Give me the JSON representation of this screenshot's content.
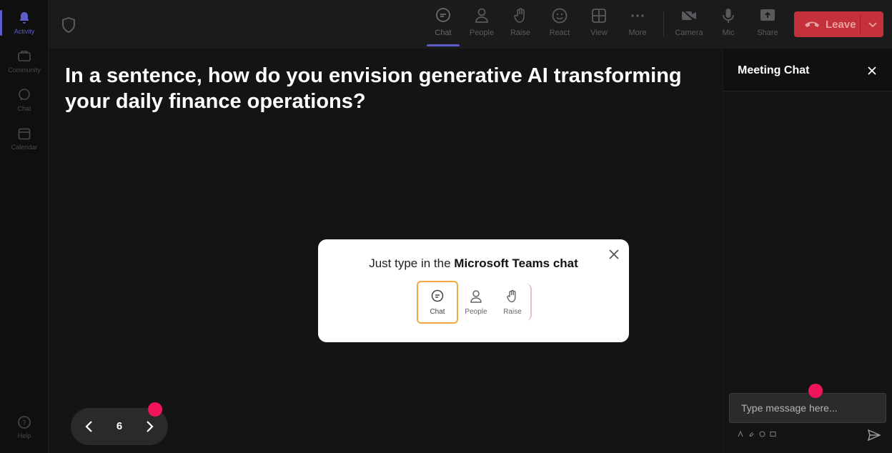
{
  "rail": {
    "items": [
      {
        "label": "Activity",
        "icon": "bell-icon",
        "active": true
      },
      {
        "label": "Community",
        "icon": "community-icon"
      },
      {
        "label": "Chat",
        "icon": "chat-icon"
      },
      {
        "label": "Calendar",
        "icon": "calendar-icon"
      }
    ],
    "help": "Help"
  },
  "topbar": {
    "buttons": {
      "chat": "Chat",
      "people": "People",
      "raise": "Raise",
      "react": "React",
      "view": "View",
      "more": "More",
      "camera": "Camera",
      "mic": "Mic",
      "share": "Share"
    },
    "leave_label": "Leave",
    "accent_color": "#5b5fc7",
    "leave_color": "#c4313b"
  },
  "stage": {
    "question": "In a sentence, how do you envision generative AI transforming your daily finance operations?",
    "pager": {
      "current": "6"
    }
  },
  "popup": {
    "text_prefix": "Just type in the ",
    "text_bold": "Microsoft Teams chat",
    "buttons": {
      "chat": "Chat",
      "people": "People",
      "raise": "Raise"
    },
    "highlight_color": "#f5a63c"
  },
  "chat_panel": {
    "title": "Meeting Chat",
    "input_placeholder": "Type message here..."
  },
  "pointer_color": "#f0145a"
}
